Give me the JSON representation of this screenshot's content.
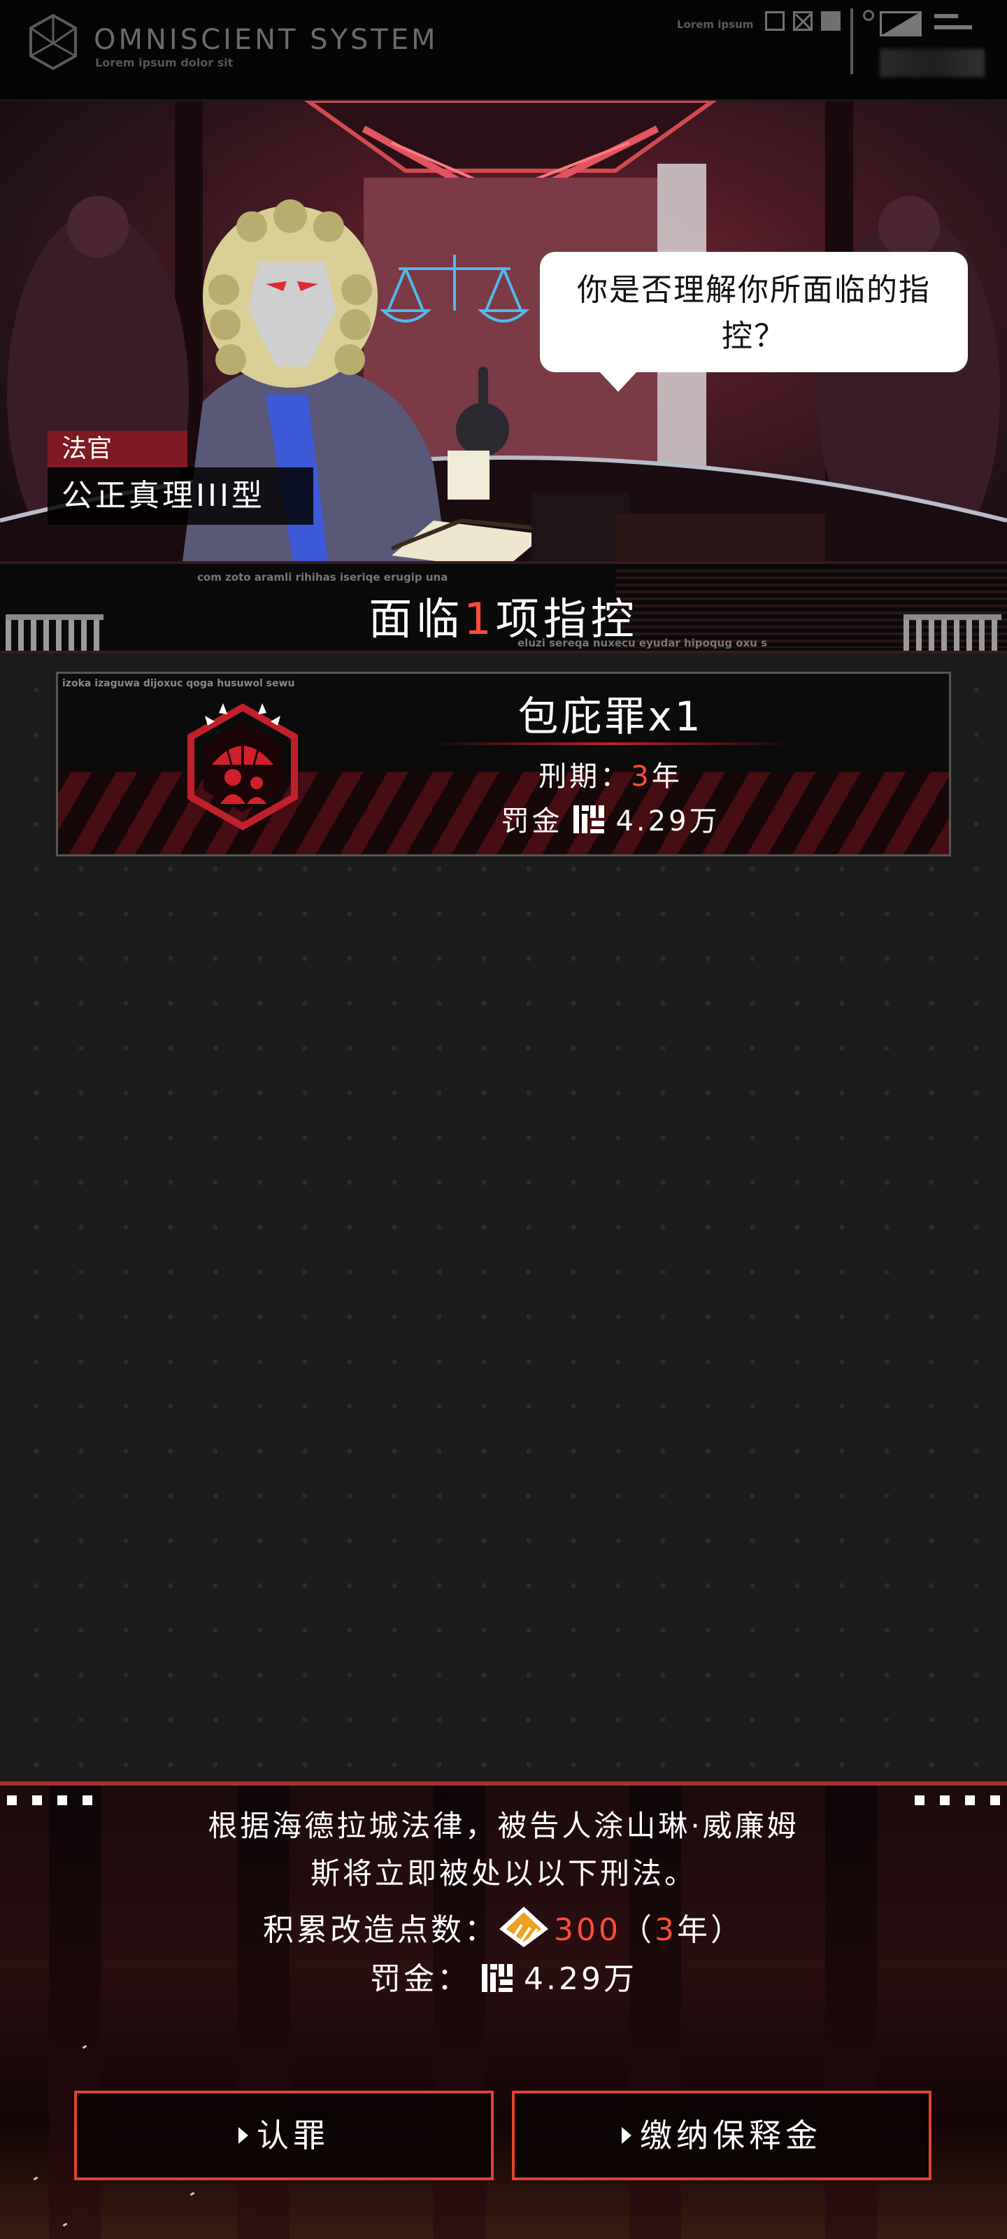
{
  "header": {
    "brand_title": "OMNISCIENT  SYSTEM",
    "brand_subtitle": "Lorem ipsum dolor sit",
    "status_label": "Lorem ipsum"
  },
  "scene": {
    "speech_line1": "你是否理解你所面临的指",
    "speech_line2": "控？",
    "judge_role": "法官",
    "judge_name": "公正真理III型"
  },
  "charges": {
    "title_prefix": "面临",
    "count": "1",
    "title_suffix": "项指控",
    "small_top": "com zoto aramli rihihas iseriqe erugip una",
    "small_bottom": "eluzi sereqa nuxecu eyudar hipoqug oxu s"
  },
  "charge_card": {
    "small": "izoka izaguwa dijoxuc qoga husuwol sewu",
    "crime": "包庇罪x1",
    "term_label": "刑期：",
    "term_value": "3",
    "term_unit": "年",
    "fine_label": "罚金",
    "fine_value": "4.29万",
    "icon": "shelter-umbrella-icon"
  },
  "verdict": {
    "text_line1": "根据海德拉城法律，被告人涂山琳·威廉姆",
    "text_line2": "斯将立即被处以以下刑法。",
    "points_label": "积累改造点数：",
    "points_value": "300",
    "points_paren_open": "（",
    "points_years": "3",
    "points_years_unit": "年）",
    "fine_label": "罚金：",
    "fine_value": "4.29万"
  },
  "buttons": {
    "plead_guilty": "认罪",
    "pay_bail": "缴纳保释金"
  },
  "colors": {
    "accent": "#ff4d3a",
    "button_border": "#e0442e",
    "crimson": "#c0202a"
  }
}
